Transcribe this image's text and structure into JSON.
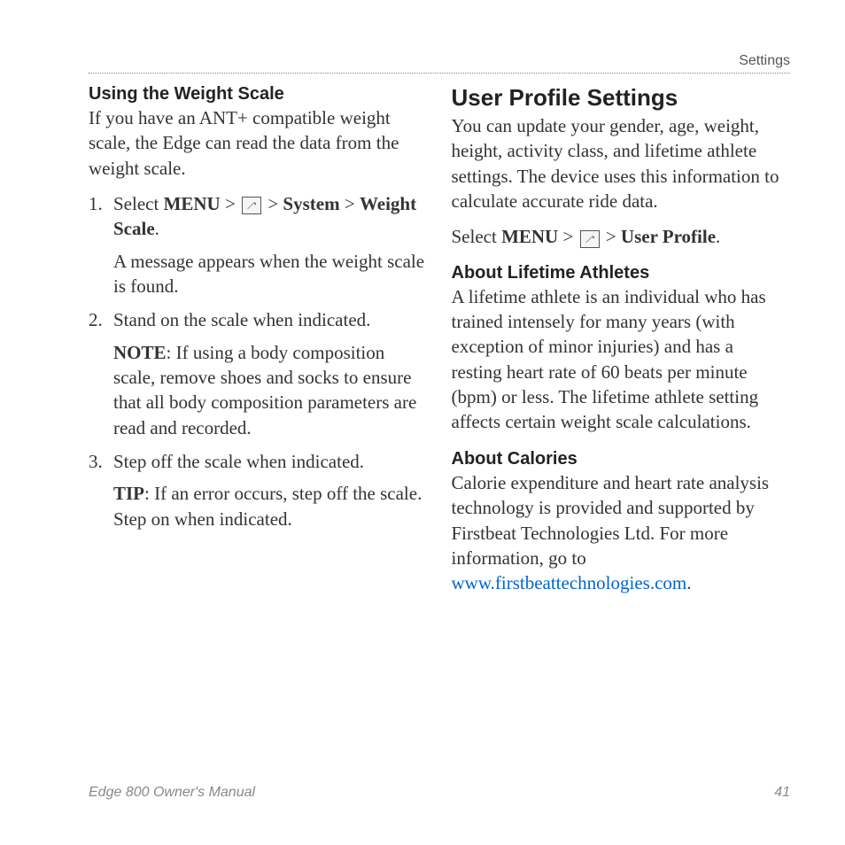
{
  "header": {
    "sectionName": "Settings"
  },
  "leftColumn": {
    "title": "Using the Weight Scale",
    "intro": "If you have an ANT+ compatible weight scale, the Edge can read the data from the weight scale.",
    "step1": {
      "prefix": "Select ",
      "menu": "MENU",
      "sep1": " > ",
      "sep2": " > ",
      "system": "System",
      "sep3": " > ",
      "weightScale": "Weight Scale",
      "suffix": ".",
      "note": "A message appears when the weight scale is found."
    },
    "step2": {
      "text": "Stand on the scale when indicated.",
      "noteLabel": "NOTE",
      "noteText": ": If using a body composition scale, remove shoes and socks to ensure that all body composition parameters are read and recorded."
    },
    "step3": {
      "text": "Step off the scale when indicated.",
      "tipLabel": "TIP",
      "tipText": ": If an error occurs, step off the scale. Step on when indicated."
    }
  },
  "rightColumn": {
    "title": "User Profile Settings",
    "intro": "You can update your gender, age, weight, height, activity class, and lifetime athlete settings. The device uses this information to calculate accurate ride data.",
    "navPath": {
      "prefix": "Select ",
      "menu": "MENU",
      "sep1": " > ",
      "sep2": " > ",
      "userProfile": "User Profile",
      "suffix": "."
    },
    "lifetimeTitle": "About Lifetime Athletes",
    "lifetimeText": "A lifetime athlete is an individual who has trained intensely for many years (with exception of minor injuries) and has a resting heart rate of 60 beats per minute (bpm) or less. The lifetime athlete setting affects certain weight scale calculations.",
    "caloriesTitle": "About Calories",
    "caloriesText": "Calorie expenditure and heart rate analysis technology is provided and supported by Firstbeat Technologies Ltd. For more information, go to ",
    "caloriesLink": "www.firstbeattechnologies.com",
    "caloriesSuffix": "."
  },
  "footer": {
    "manualTitle": "Edge 800 Owner's Manual",
    "pageNumber": "41"
  }
}
